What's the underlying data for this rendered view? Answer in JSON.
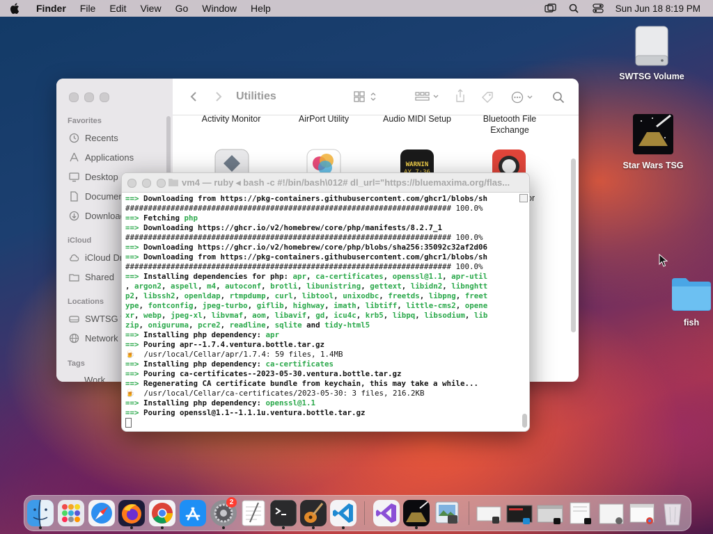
{
  "menubar": {
    "app_name": "Finder",
    "items": [
      "File",
      "Edit",
      "View",
      "Go",
      "Window",
      "Help"
    ],
    "datetime": "Sun Jun 18  8:19 PM"
  },
  "desktop": {
    "icons": [
      {
        "label": "SWTSG Volume",
        "kind": "drive-icon"
      },
      {
        "label": "Star Wars TSG",
        "kind": "app-icon"
      },
      {
        "label": "fish",
        "kind": "folder-icon"
      }
    ]
  },
  "finder": {
    "title": "Utilities",
    "sidebar": {
      "favorites_header": "Favorites",
      "favorites": [
        "Recents",
        "Applications",
        "Desktop",
        "Documents",
        "Downloads"
      ],
      "icloud_header": "iCloud",
      "icloud": [
        "iCloud Drive",
        "Shared"
      ],
      "locations_header": "Locations",
      "locations": [
        "SWTSG Volume",
        "Network"
      ],
      "tags_header": "Tags",
      "tags": [
        "Work"
      ]
    },
    "items": [
      "Activity Monitor",
      "AirPort Utility",
      "Audio MIDI Setup",
      "Bluetooth File Exchange"
    ],
    "partial_label": "or"
  },
  "terminal": {
    "title": "vm4 — ruby ◂ bash -c #!/bin/bash\\012# dl_url=\"https://bluemaxima.org/flas...",
    "lines": [
      [
        {
          "t": "==> ",
          "c": "arrow"
        },
        {
          "t": "Downloading from https://pkg-containers.githubusercontent.com/ghcr1/blobs/sh",
          "c": "b"
        }
      ],
      [
        {
          "t": "######################################################################## 100.0%",
          "c": ""
        }
      ],
      [
        {
          "t": "==> ",
          "c": "arrow"
        },
        {
          "t": "Fetching ",
          "c": "b"
        },
        {
          "t": "php",
          "c": "g"
        }
      ],
      [
        {
          "t": "==> ",
          "c": "arrow"
        },
        {
          "t": "Downloading https://ghcr.io/v2/homebrew/core/php/manifests/8.2.7_1",
          "c": "b"
        }
      ],
      [
        {
          "t": "######################################################################## 100.0%",
          "c": ""
        }
      ],
      [
        {
          "t": "==> ",
          "c": "arrow"
        },
        {
          "t": "Downloading https://ghcr.io/v2/homebrew/core/php/blobs/sha256:35092c32af2d06",
          "c": "b"
        }
      ],
      [
        {
          "t": "==> ",
          "c": "arrow"
        },
        {
          "t": "Downloading from https://pkg-containers.githubusercontent.com/ghcr1/blobs/sh",
          "c": "b"
        }
      ],
      [
        {
          "t": "######################################################################## 100.0%",
          "c": ""
        }
      ],
      [
        {
          "t": "==> ",
          "c": "arrow"
        },
        {
          "t": "Installing dependencies for php: ",
          "c": "b"
        },
        {
          "t": "apr",
          "c": "g"
        },
        {
          "t": ", ",
          "c": "b"
        },
        {
          "t": "ca-certificates",
          "c": "g"
        },
        {
          "t": ", ",
          "c": "b"
        },
        {
          "t": "openssl@1.1",
          "c": "g"
        },
        {
          "t": ", ",
          "c": "b"
        },
        {
          "t": "apr-util",
          "c": "g"
        }
      ],
      [
        {
          "t": ", ",
          "c": "b"
        },
        {
          "t": "argon2",
          "c": "g"
        },
        {
          "t": ", ",
          "c": "b"
        },
        {
          "t": "aspell",
          "c": "g"
        },
        {
          "t": ", ",
          "c": "b"
        },
        {
          "t": "m4",
          "c": "g"
        },
        {
          "t": ", ",
          "c": "b"
        },
        {
          "t": "autoconf",
          "c": "g"
        },
        {
          "t": ", ",
          "c": "b"
        },
        {
          "t": "brotli",
          "c": "g"
        },
        {
          "t": ", ",
          "c": "b"
        },
        {
          "t": "libunistring",
          "c": "g"
        },
        {
          "t": ", ",
          "c": "b"
        },
        {
          "t": "gettext",
          "c": "g"
        },
        {
          "t": ", ",
          "c": "b"
        },
        {
          "t": "libidn2",
          "c": "g"
        },
        {
          "t": ", ",
          "c": "b"
        },
        {
          "t": "libnghtt",
          "c": "g"
        }
      ],
      [
        {
          "t": "p2",
          "c": "g"
        },
        {
          "t": ", ",
          "c": "b"
        },
        {
          "t": "libssh2",
          "c": "g"
        },
        {
          "t": ", ",
          "c": "b"
        },
        {
          "t": "openldap",
          "c": "g"
        },
        {
          "t": ", ",
          "c": "b"
        },
        {
          "t": "rtmpdump",
          "c": "g"
        },
        {
          "t": ", ",
          "c": "b"
        },
        {
          "t": "curl",
          "c": "g"
        },
        {
          "t": ", ",
          "c": "b"
        },
        {
          "t": "libtool",
          "c": "g"
        },
        {
          "t": ", ",
          "c": "b"
        },
        {
          "t": "unixodbc",
          "c": "g"
        },
        {
          "t": ", ",
          "c": "b"
        },
        {
          "t": "freetds",
          "c": "g"
        },
        {
          "t": ", ",
          "c": "b"
        },
        {
          "t": "libpng",
          "c": "g"
        },
        {
          "t": ", ",
          "c": "b"
        },
        {
          "t": "freet",
          "c": "g"
        }
      ],
      [
        {
          "t": "ype",
          "c": "g"
        },
        {
          "t": ", ",
          "c": "b"
        },
        {
          "t": "fontconfig",
          "c": "g"
        },
        {
          "t": ", ",
          "c": "b"
        },
        {
          "t": "jpeg-turbo",
          "c": "g"
        },
        {
          "t": ", ",
          "c": "b"
        },
        {
          "t": "giflib",
          "c": "g"
        },
        {
          "t": ", ",
          "c": "b"
        },
        {
          "t": "highway",
          "c": "g"
        },
        {
          "t": ", ",
          "c": "b"
        },
        {
          "t": "imath",
          "c": "g"
        },
        {
          "t": ", ",
          "c": "b"
        },
        {
          "t": "libtiff",
          "c": "g"
        },
        {
          "t": ", ",
          "c": "b"
        },
        {
          "t": "little-cms2",
          "c": "g"
        },
        {
          "t": ", ",
          "c": "b"
        },
        {
          "t": "opene",
          "c": "g"
        }
      ],
      [
        {
          "t": "xr",
          "c": "g"
        },
        {
          "t": ", ",
          "c": "b"
        },
        {
          "t": "webp",
          "c": "g"
        },
        {
          "t": ", ",
          "c": "b"
        },
        {
          "t": "jpeg-xl",
          "c": "g"
        },
        {
          "t": ", ",
          "c": "b"
        },
        {
          "t": "libvmaf",
          "c": "g"
        },
        {
          "t": ", ",
          "c": "b"
        },
        {
          "t": "aom",
          "c": "g"
        },
        {
          "t": ", ",
          "c": "b"
        },
        {
          "t": "libavif",
          "c": "g"
        },
        {
          "t": ", ",
          "c": "b"
        },
        {
          "t": "gd",
          "c": "g"
        },
        {
          "t": ", ",
          "c": "b"
        },
        {
          "t": "icu4c",
          "c": "g"
        },
        {
          "t": ", ",
          "c": "b"
        },
        {
          "t": "krb5",
          "c": "g"
        },
        {
          "t": ", ",
          "c": "b"
        },
        {
          "t": "libpq",
          "c": "g"
        },
        {
          "t": ", ",
          "c": "b"
        },
        {
          "t": "libsodium",
          "c": "g"
        },
        {
          "t": ", ",
          "c": "b"
        },
        {
          "t": "lib",
          "c": "g"
        }
      ],
      [
        {
          "t": "zip",
          "c": "g"
        },
        {
          "t": ", ",
          "c": "b"
        },
        {
          "t": "oniguruma",
          "c": "g"
        },
        {
          "t": ", ",
          "c": "b"
        },
        {
          "t": "pcre2",
          "c": "g"
        },
        {
          "t": ", ",
          "c": "b"
        },
        {
          "t": "readline",
          "c": "g"
        },
        {
          "t": ", ",
          "c": "b"
        },
        {
          "t": "sqlite",
          "c": "g"
        },
        {
          "t": " and ",
          "c": "b"
        },
        {
          "t": "tidy-html5",
          "c": "g"
        }
      ],
      [
        {
          "t": "==> ",
          "c": "arrow"
        },
        {
          "t": "Installing php dependency: ",
          "c": "b"
        },
        {
          "t": "apr",
          "c": "g"
        }
      ],
      [
        {
          "t": "==> ",
          "c": "arrow"
        },
        {
          "t": "Pouring apr--1.7.4.ventura.bottle.tar.gz",
          "c": "b"
        }
      ],
      [
        {
          "t": "🍺  ",
          "c": ""
        },
        {
          "t": "/usr/local/Cellar/apr/1.7.4: 59 files, 1.4MB",
          "c": ""
        }
      ],
      [
        {
          "t": "==> ",
          "c": "arrow"
        },
        {
          "t": "Installing php dependency: ",
          "c": "b"
        },
        {
          "t": "ca-certificates",
          "c": "g"
        }
      ],
      [
        {
          "t": "==> ",
          "c": "arrow"
        },
        {
          "t": "Pouring ca-certificates--2023-05-30.ventura.bottle.tar.gz",
          "c": "b"
        }
      ],
      [
        {
          "t": "==> ",
          "c": "arrow"
        },
        {
          "t": "Regenerating CA certificate bundle from keychain, this may take a while...",
          "c": "b"
        }
      ],
      [
        {
          "t": "🍺  ",
          "c": ""
        },
        {
          "t": "/usr/local/Cellar/ca-certificates/2023-05-30: 3 files, 216.2KB",
          "c": ""
        }
      ],
      [
        {
          "t": "==> ",
          "c": "arrow"
        },
        {
          "t": "Installing php dependency: ",
          "c": "b"
        },
        {
          "t": "openssl@1.1",
          "c": "g"
        }
      ],
      [
        {
          "t": "==> ",
          "c": "arrow"
        },
        {
          "t": "Pouring openssl@1.1--1.1.1u.ventura.bottle.tar.gz",
          "c": "b"
        }
      ]
    ]
  },
  "dock": {
    "apps": [
      "finder-icon",
      "launchpad-icon",
      "safari-icon",
      "firefox-icon",
      "chrome-icon",
      "app-store-icon",
      "system-settings-icon",
      "textedit-icon",
      "terminal-icon",
      "garageband-icon",
      "vscode-icon",
      "visual-studio-icon",
      "star-wars-tsg-icon",
      "preview-icon"
    ],
    "settings_badge": "2"
  },
  "colors": {
    "prompt_green": "#2aa84a",
    "badge_red": "#ff3b30"
  }
}
